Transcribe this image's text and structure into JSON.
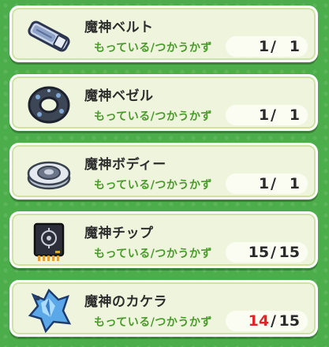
{
  "subtitle_label": "もっている/つかうかず",
  "items": [
    {
      "name": "魔神ベルト",
      "icon": "belt-icon",
      "have": "1",
      "need": "1",
      "short": false
    },
    {
      "name": "魔神ベゼル",
      "icon": "bezel-icon",
      "have": "1",
      "need": "1",
      "short": false
    },
    {
      "name": "魔神ボディー",
      "icon": "body-icon",
      "have": "1",
      "need": "1",
      "short": false
    },
    {
      "name": "魔神チップ",
      "icon": "chip-icon",
      "have": "15",
      "need": "15",
      "short": false
    },
    {
      "name": "魔神のカケラ",
      "icon": "shard-icon",
      "have": "14",
      "need": "15",
      "short": true
    }
  ],
  "colors": {
    "background": "#4cae4a",
    "card": "#eef5dc",
    "subtitle": "#4a9a2c",
    "shortage": "#e0242a"
  }
}
